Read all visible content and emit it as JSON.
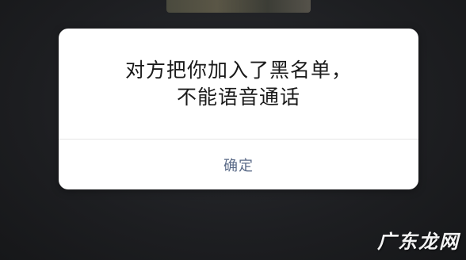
{
  "dialog": {
    "message_line1": "对方把你加入了黑名单，",
    "message_line2": "不能语音通话",
    "confirm_label": "确定"
  },
  "watermark": {
    "text": "广东龙网"
  }
}
